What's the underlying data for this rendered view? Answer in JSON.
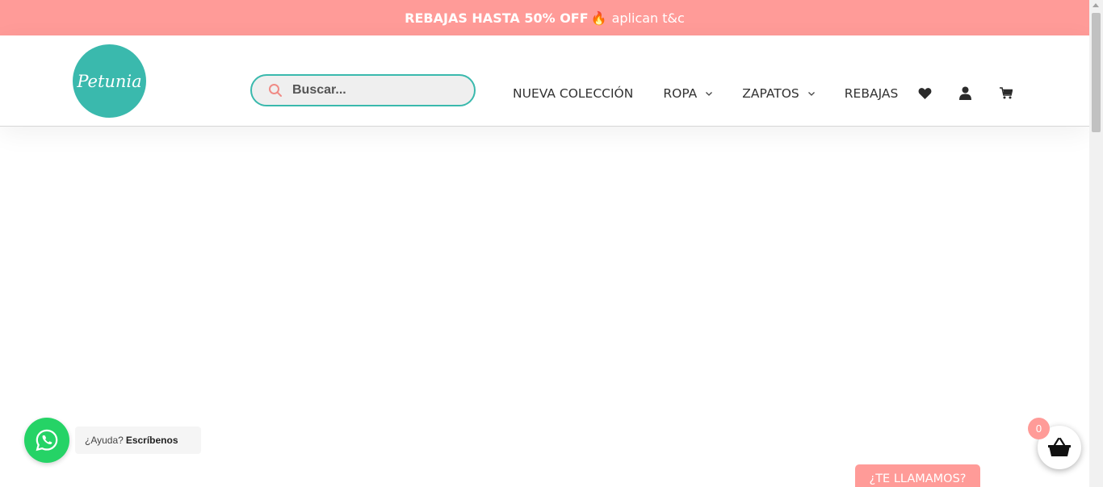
{
  "announcement": {
    "bold": "REBAJAS HASTA 50% OFF",
    "emoji": "🔥",
    "rest": "aplican t&c"
  },
  "logo": {
    "text": "Petunia",
    "color": "#3ab9ad"
  },
  "search": {
    "placeholder": "Buscar...",
    "value": ""
  },
  "nav": {
    "items": [
      {
        "label": "NUEVA COLECCIÓN",
        "has_dropdown": false
      },
      {
        "label": "ROPA",
        "has_dropdown": true
      },
      {
        "label": "ZAPATOS",
        "has_dropdown": true
      },
      {
        "label": "REBAJAS",
        "has_dropdown": false
      }
    ],
    "icons": [
      "heart-icon",
      "user-icon",
      "cart-icon"
    ]
  },
  "whatsapp": {
    "prefix": "¿Ayuda?",
    "action": "Escríbenos"
  },
  "cart_widget": {
    "count": "0"
  },
  "call_button": {
    "label": "¿TE LLAMAMOS?"
  },
  "colors": {
    "accent_pink": "#ff9b98",
    "accent_teal": "#3ab9ad",
    "whatsapp_green": "#25d366"
  }
}
